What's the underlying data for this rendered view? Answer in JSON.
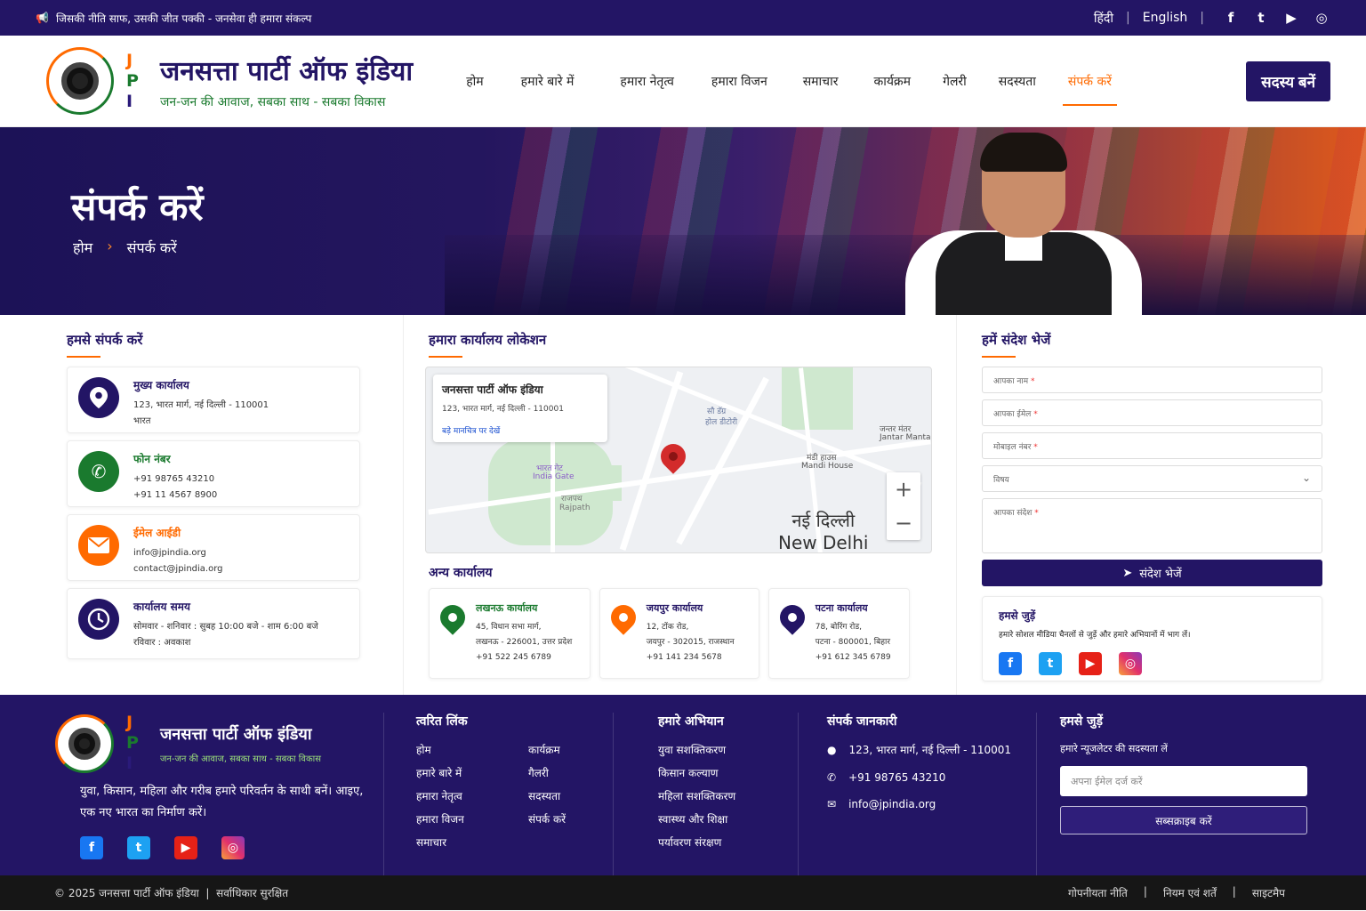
{
  "topbar": {
    "tagline": "जिसकी नीति साफ, उसकी जीत पक्की - जनसेवा ही हमारा संकल्प",
    "lang_hindi": "हिंदी",
    "lang_english": "English",
    "socials": [
      "facebook-icon",
      "twitter-icon",
      "youtube-icon",
      "instagram-icon"
    ]
  },
  "header": {
    "logo_letters": [
      "J",
      "P",
      "I"
    ],
    "brand_name": "जनसत्ता पार्टी ऑफ इंडिया",
    "brand_tagline": "जन-जन की आवाज, सबका साथ - सबका विकास",
    "nav": [
      "होम",
      "हमारे बारे में",
      "हमारा नेतृत्व",
      "हमारा विजन",
      "समाचार",
      "कार्यक्रम",
      "गेलरी",
      "सदस्यता",
      "संपर्क करें"
    ],
    "active_nav": "संपर्क करें",
    "join_button": "सदस्य बनें"
  },
  "hero": {
    "title": "संपर्क करें",
    "breadcrumb": [
      "होम",
      "संपर्क करें"
    ]
  },
  "contact": {
    "title": "हमसे संपर्क करें",
    "cards": [
      {
        "icon": "location-pin-icon",
        "color": "#231565",
        "title": "मुख्य कार्यालय",
        "title_color": "#231565",
        "lines": [
          "123, भारत मार्ग, नई दिल्ली - 110001",
          "भारत"
        ]
      },
      {
        "icon": "phone-icon",
        "color": "#1a7a2e",
        "title": "फोन नंबर",
        "title_color": "#1a7a2e",
        "lines": [
          "+91 98765 43210",
          "+91 11 4567 8900"
        ]
      },
      {
        "icon": "mail-icon",
        "color": "#ff6a00",
        "title": "ईमेल आईडी",
        "title_color": "#ff6a00",
        "lines": [
          "info@jpindia.org",
          "contact@jpindia.org"
        ]
      },
      {
        "icon": "clock-icon",
        "color": "#231565",
        "title": "कार्यालय समय",
        "title_color": "#231565",
        "lines": [
          "सोमवार - शनिवार : सुबह 10:00 बजे - शाम 6:00 बजे",
          "रविवार : अवकाश"
        ]
      }
    ]
  },
  "location": {
    "title": "हमारा कार्यालय लोकेशन",
    "map": {
      "info_title": "जनसत्ता पार्टी ऑफ इंडिया",
      "info_address": "123, भारत मार्ग, नई दिल्ली - 110001",
      "info_link": "बड़े मानचित्र पर देखें",
      "labels": {
        "india_gate_hi": "भारत गेट",
        "india_gate_en": "India Gate",
        "rajpath_hi": "राजपथ",
        "rajpath_en": "Rajpath",
        "jantar_hi": "जन्तर मंतर",
        "jantar_en": "Jantar Manta",
        "mandi_hi": "मंडी हाउस",
        "mandi_en": "Mandi House",
        "top_hi": "सौ डॅग्र",
        "top_hi2": "होल डीटोरी",
        "city_hi": "नई दिल्ली",
        "city_en": "New Delhi"
      },
      "zoom_in": "+",
      "zoom_out": "−"
    },
    "other_title": "अन्य कार्यालय",
    "offices": [
      {
        "color": "#1a7a2e",
        "name": "लखनऊ कार्यालय",
        "lines": [
          "45, विधान सभा मार्ग,",
          "लखनऊ - 226001, उत्तर प्रदेश",
          "+91 522 245 6789"
        ]
      },
      {
        "color": "#ff6a00",
        "name": "जयपुर कार्यालय",
        "lines": [
          "12, टोंक रोड,",
          "जयपुर - 302015, राजस्थान",
          "+91 141 234 5678"
        ]
      },
      {
        "color": "#231565",
        "name": "पटना कार्यालय",
        "lines": [
          "78, बोरिंग रोड,",
          "पटना - 800001, बिहार",
          "+91 612 345 6789"
        ]
      }
    ]
  },
  "message": {
    "title": "हमें संदेश भेजें",
    "name_placeholder": "आपका नाम",
    "email_placeholder": "आपका ईमेल",
    "mobile_placeholder": "मोबाइल नंबर",
    "subject_placeholder": "विषय",
    "message_placeholder": "आपका संदेश",
    "required_mark": "*",
    "send_button": "संदेश भेजें",
    "connect_title": "हमसे जुड़ें",
    "connect_text": "हमारे सोशल मीडिया चैनलों से जुड़ें और हमारे अभियानों में भाग लें।"
  },
  "footer": {
    "brand_name": "जनसत्ता पार्टी ऑफ इंडिया",
    "brand_tagline": "जन-जन की आवाज, सबका साथ - सबका विकास",
    "about": "युवा, किसान, महिला और गरीब हमारे परिवर्तन के साथी बनें। आइए, एक नए भारत का निर्माण करें।",
    "quick_title": "त्वरित लिंक",
    "quick_links": [
      "होम",
      "कार्यक्रम",
      "हमारे बारे में",
      "गैलरी",
      "हमारा नेतृत्व",
      "सदस्यता",
      "हमारा विजन",
      "संपर्क करें",
      "समाचार"
    ],
    "campaign_title": "हमारे अभियान",
    "campaigns": [
      "युवा सशक्तिकरण",
      "किसान कल्याण",
      "महिला सशक्तिकरण",
      "स्वास्थ्य और शिक्षा",
      "पर्यावरण संरक्षण"
    ],
    "contact_title": "संपर्क जानकारी",
    "contact_address": "123, भारत मार्ग, नई दिल्ली - 110001",
    "contact_phone": "+91 98765 43210",
    "contact_email": "info@jpindia.org",
    "newsletter_title": "हमसे जुड़ें",
    "newsletter_text": "हमारे न्यूजलेटर की सदस्यता लें",
    "newsletter_placeholder": "अपना ईमेल दर्ज करें",
    "subscribe_button": "सब्सक्राइब करें"
  },
  "bottom": {
    "copyright": "© 2025 जनसत्ता पार्टी ऑफ इंडिया  |  सर्वाधिकार सुरक्षित",
    "links": [
      "गोपनीयता नीति",
      "नियम एवं शर्तें",
      "साइटमैप"
    ]
  }
}
